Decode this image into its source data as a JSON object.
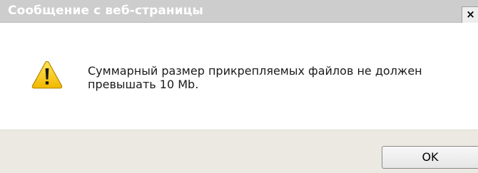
{
  "window": {
    "title": "Сообщение с веб-страницы",
    "close_label": "×"
  },
  "message": {
    "text": "Суммарный размер прикрепляемых файлов не должен превышать 10 Mb.",
    "icon": "warning-icon"
  },
  "buttons": {
    "ok_label": "OK"
  },
  "colors": {
    "titlebar": "#cdcdcd",
    "footer": "#ece9e2",
    "icon_fill": "#f6c400"
  }
}
